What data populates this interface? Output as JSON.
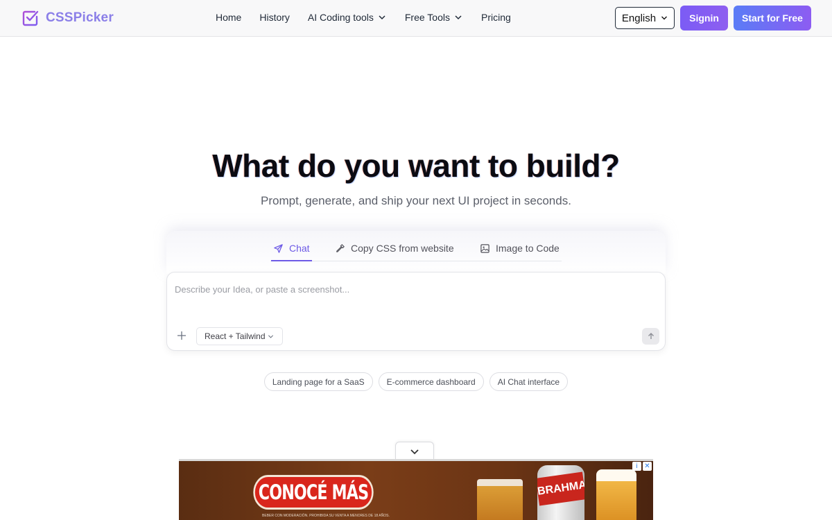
{
  "brand": {
    "name": "CSSPicker",
    "color": "#8b7fe8"
  },
  "nav": {
    "home": "Home",
    "history": "History",
    "ai_tools": "AI Coding tools",
    "free_tools": "Free Tools",
    "pricing": "Pricing"
  },
  "header_actions": {
    "language": "English",
    "signin": "Signin",
    "start": "Start for Free"
  },
  "hero": {
    "title": "What do you want to build?",
    "subtitle": "Prompt, generate, and ship your next UI project in seconds."
  },
  "tabs": [
    {
      "label": "Chat",
      "icon": "send-icon",
      "active": true
    },
    {
      "label": "Copy CSS from website",
      "icon": "eyedropper-icon",
      "active": false
    },
    {
      "label": "Image to Code",
      "icon": "image-icon",
      "active": false
    }
  ],
  "prompt": {
    "placeholder": "Describe your Idea, or paste a screenshot...",
    "value": "",
    "framework": "React + Tailwind"
  },
  "suggestions": [
    "Landing page for a SaaS",
    "E-commerce dashboard",
    "AI Chat interface"
  ],
  "ad": {
    "cta": "CONOCÉ MÁS",
    "can_label": "BRAHMA",
    "fine_print": "BEBER CON MODERACIÓN. PROHIBIDA SU VENTA A MENORES DE 18 AÑOS.",
    "info": "i",
    "close": "✕"
  },
  "colors": {
    "accent": "#6d5ae6",
    "signin_bg": "#7b5cf5",
    "start_bg": "#5a7cf6"
  }
}
